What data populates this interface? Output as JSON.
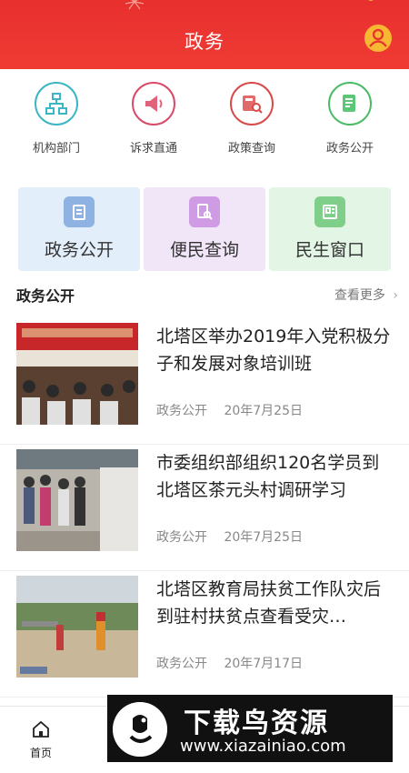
{
  "header": {
    "title": "政务",
    "user_icon": "user-icon",
    "color": "#e8302e"
  },
  "quick": [
    {
      "label": "机构部门",
      "icon": "org-chart-icon",
      "color": "#3bb6c4"
    },
    {
      "label": "诉求直通",
      "icon": "megaphone-icon",
      "color": "#d84a68"
    },
    {
      "label": "政策查询",
      "icon": "policy-search-icon",
      "color": "#d84a4a"
    },
    {
      "label": "政务公开",
      "icon": "document-icon",
      "color": "#4cbb66"
    }
  ],
  "cards": [
    {
      "label": "政务公开",
      "icon": "clipboard-icon",
      "bg": "#e3eefb",
      "icon_bg": "#8eb3e3"
    },
    {
      "label": "便民查询",
      "icon": "search-doc-icon",
      "bg": "#f1e5f8",
      "icon_bg": "#cf9be4"
    },
    {
      "label": "民生窗口",
      "icon": "id-card-icon",
      "bg": "#e3f5e4",
      "icon_bg": "#7fcf8a"
    }
  ],
  "section": {
    "title": "政务公开",
    "more": "查看更多"
  },
  "news": [
    {
      "title": "北塔区举办2019年入党积极分子和发展对象培训班",
      "category": "政务公开",
      "date": "20年7月25日"
    },
    {
      "title": "市委组织部组织120名学员到北塔区茶元头村调研学习",
      "category": "政务公开",
      "date": "20年7月25日"
    },
    {
      "title": "北塔区教育局扶贫工作队灾后到驻村扶贫点查看受灾…",
      "category": "政务公开",
      "date": "20年7月17日"
    }
  ],
  "tabbar": {
    "home": "首页"
  },
  "watermark": {
    "text": "下载鸟资源",
    "url": "www.xiazainiao.com"
  }
}
